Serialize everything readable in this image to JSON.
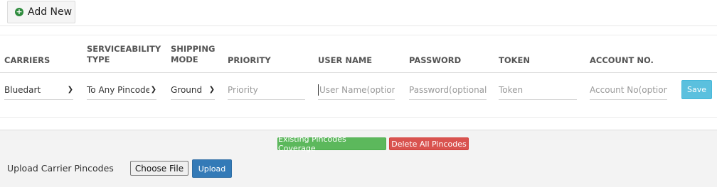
{
  "toolbar": {
    "add_new_label": "Add New",
    "add_icon": "plus-circle-icon"
  },
  "table": {
    "headers": {
      "carriers": "CARRIERS",
      "serviceability_1": "SERVICEABILITY",
      "serviceability_2": "TYPE",
      "shipping_1": "SHIPPING",
      "shipping_2": "MODE",
      "priority": "PRIORITY",
      "username": "USER NAME",
      "password": "PASSWORD",
      "token": "TOKEN",
      "account": "ACCOUNT NO."
    },
    "row": {
      "carrier_value": "Bluedart",
      "serviceability_value": "To Any Pincode",
      "shipping_value": "Ground",
      "priority_placeholder": "Priority",
      "username_placeholder": "User Name(optional)",
      "password_placeholder": "Password(optional)",
      "token_placeholder": "Token",
      "account_placeholder": "Account No(optional)",
      "save_label": "Save"
    }
  },
  "bottom": {
    "existing_coverage_label": "Existing Pincodes Coverage",
    "delete_all_label": "Delete All Pincodes",
    "upload_label": "Upload Carrier Pincodes",
    "choose_file_label": "Choose File",
    "upload_button_label": "Upload"
  },
  "colors": {
    "green": "#5cb85c",
    "red": "#d9534f",
    "info": "#5bc0de",
    "primary": "#337ab7"
  }
}
